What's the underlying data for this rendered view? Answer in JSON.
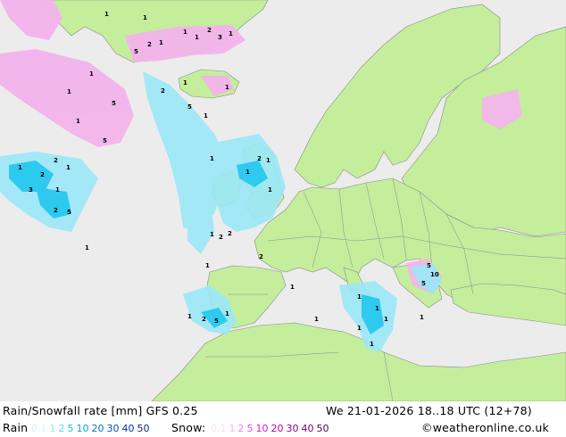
{
  "header": {
    "title": "Rain/Snowfall rate [mm]",
    "model": "GFS 0.25",
    "valid_time": "We 21-01-2026 18..18 UTC (12+78)"
  },
  "legend": {
    "rain_label": "Rain",
    "rain_scale": [
      {
        "value": "0.1",
        "color": "#d4f4fb"
      },
      {
        "value": "1",
        "color": "#9be8f8"
      },
      {
        "value": "2",
        "color": "#55d8f4"
      },
      {
        "value": "5",
        "color": "#1ac4ee"
      },
      {
        "value": "10",
        "color": "#0aa0e0"
      },
      {
        "value": "20",
        "color": "#0774c8"
      },
      {
        "value": "30",
        "color": "#0550b0"
      },
      {
        "value": "40",
        "color": "#06349a"
      },
      {
        "value": "50",
        "color": "#0b1f80"
      }
    ],
    "snow_label": "Snow:",
    "snow_scale": [
      {
        "value": "0.1",
        "color": "#fbe0f6"
      },
      {
        "value": "1",
        "color": "#f3b4ec"
      },
      {
        "value": "2",
        "color": "#ec86e2"
      },
      {
        "value": "5",
        "color": "#e04ed8"
      },
      {
        "value": "10",
        "color": "#cc20c8"
      },
      {
        "value": "20",
        "color": "#a80aa6"
      },
      {
        "value": "30",
        "color": "#880888"
      },
      {
        "value": "40",
        "color": "#6c066c"
      },
      {
        "value": "50",
        "color": "#520452"
      }
    ]
  },
  "credit": "©weatheronline.co.uk",
  "colors": {
    "sea": "#ececec",
    "land": "#c4ee9c",
    "coast": "#8a8a8a",
    "rain_light": "#9be8f8",
    "snow_light": "#f3b4ec"
  },
  "markers": [
    "1",
    "2",
    "3",
    "5",
    "10"
  ]
}
